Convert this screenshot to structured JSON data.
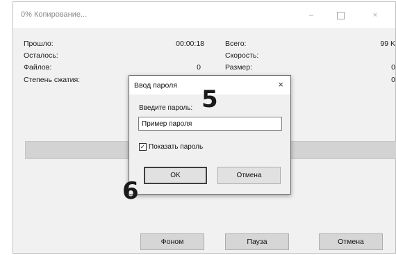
{
  "window": {
    "title": "0% Копирование...",
    "minimize_label": "–",
    "close_label": "×"
  },
  "stats_left": [
    {
      "label": "Прошло:",
      "value": "00:00:18"
    },
    {
      "label": "Осталось:",
      "value": ""
    },
    {
      "label": "Файлов:",
      "value": "0"
    },
    {
      "label": "Степень сжатия:",
      "value": ""
    }
  ],
  "stats_right": [
    {
      "label": "Всего:",
      "value": "99 K"
    },
    {
      "label": "Скорость:",
      "value": ""
    },
    {
      "label": "Размер:",
      "value": "0"
    },
    {
      "label": "",
      "value": "0"
    }
  ],
  "progress": {
    "percent": 0
  },
  "buttons": {
    "background": "Фоном",
    "pause": "Пауза",
    "cancel": "Отмена"
  },
  "password_dialog": {
    "title": "Ввод пароля",
    "close_label": "×",
    "prompt": "Введите пароль:",
    "password_value": "Пример пароля",
    "show_password_label": "Показать пароль",
    "show_password_checked": true,
    "ok_label": "OK",
    "cancel_label": "Отмена"
  },
  "annotations": {
    "step_5": "5",
    "step_6": "6"
  }
}
